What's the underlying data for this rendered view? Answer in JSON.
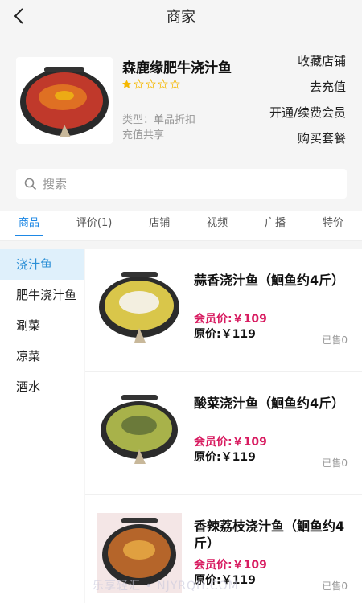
{
  "header": {
    "title": "商家"
  },
  "shop": {
    "name": "森鹿缘肥牛浇汁鱼",
    "rating": 1,
    "rating_max": 5,
    "type_label": "类型：单品折扣",
    "share_label": "充值共享",
    "actions": [
      "收藏店铺",
      "去充值",
      "开通/续费会员",
      "购买套餐"
    ]
  },
  "search": {
    "placeholder": "搜索",
    "value": ""
  },
  "tabs": [
    "商品",
    "评价(1)",
    "店铺",
    "视频",
    "广播",
    "特价"
  ],
  "categories": [
    "浇汁鱼",
    "肥牛浇汁鱼",
    "涮菜",
    "凉菜",
    "酒水"
  ],
  "items": [
    {
      "name": "蒜香浇汁鱼（鮰鱼约4斤）",
      "member_price": "会员价:￥109",
      "price": "原价:￥119",
      "sold": "已售0"
    },
    {
      "name": "酸菜浇汁鱼（鮰鱼约4斤）",
      "member_price": "会员价:￥109",
      "price": "原价:￥119",
      "sold": "已售0"
    },
    {
      "name": "香辣荔枝浇汁鱼（鮰鱼约4斤）",
      "member_price": "会员价:￥109",
      "price": "原价:￥119",
      "sold": "已售0"
    }
  ],
  "watermark": "乐享轻汇 • NJYRQH.COM",
  "colors": {
    "accent": "#1e88e5",
    "member_price": "#d81b60",
    "star": "#f5b800"
  }
}
